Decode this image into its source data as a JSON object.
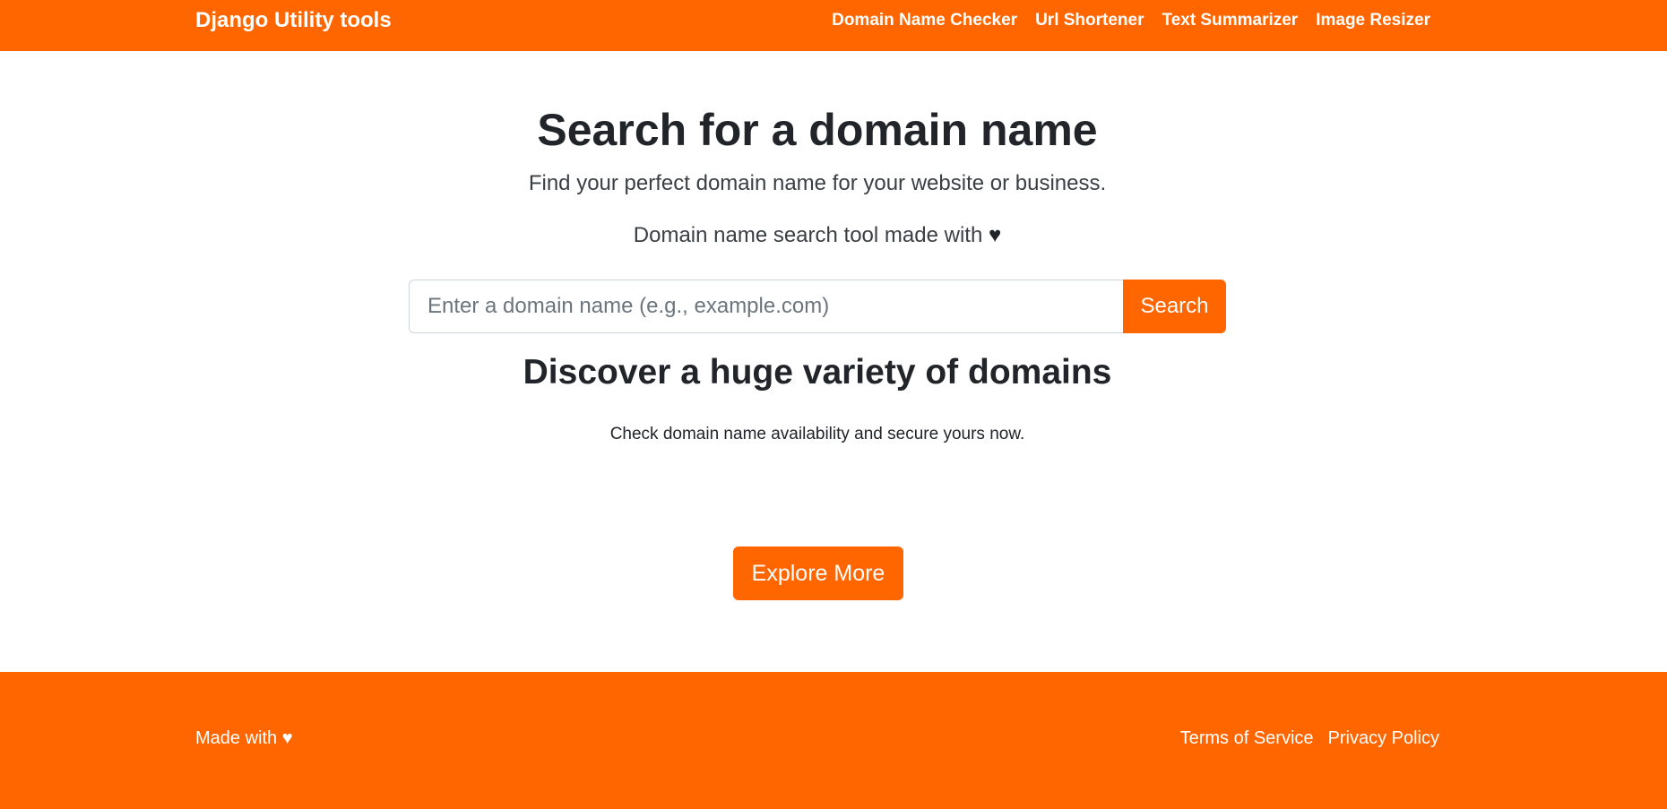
{
  "navbar": {
    "brand": "Django Utility tools",
    "links": [
      "Domain Name Checker",
      "Url Shortener",
      "Text Summarizer",
      "Image Resizer"
    ]
  },
  "hero": {
    "title": "Search for a domain name",
    "subtitle": "Find your perfect domain name for your website or business.",
    "made_with": "Domain name search tool made with",
    "made_with_icon": "heart-icon"
  },
  "search": {
    "placeholder": "Enter a domain name (e.g., example.com)",
    "value": "",
    "button_label": "Search"
  },
  "discover": {
    "title": "Discover a huge variety of domains",
    "text": "Check domain name availability and secure yours now.",
    "button_label": "Explore More"
  },
  "footer": {
    "made_with": "Made with",
    "made_with_icon": "heart-icon",
    "links": [
      "Terms of Service",
      "Privacy Policy"
    ]
  },
  "colors": {
    "brand": "#ff6600",
    "text": "#212529",
    "white": "#ffffff"
  }
}
